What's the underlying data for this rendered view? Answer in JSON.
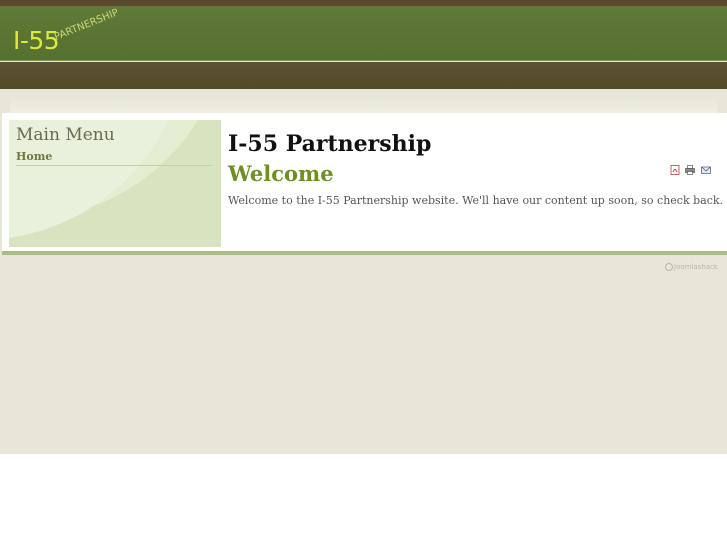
{
  "header": {
    "logo_main": "I-55",
    "logo_sub": "PARTNERSHIP"
  },
  "sidebar": {
    "title": "Main Menu",
    "items": [
      {
        "label": "Home"
      }
    ]
  },
  "main": {
    "title": "I-55 Partnership",
    "subtitle": "Welcome",
    "body": "Welcome to the I-55 Partnership website.  We'll have our content up soon, so check back."
  },
  "toolbar": {
    "icons": [
      "pdf-icon",
      "print-icon",
      "email-icon"
    ]
  },
  "footer": {
    "credit": "Joomlashack"
  },
  "colors": {
    "header_green": "#5a7432",
    "nav_brown": "#56492b",
    "page_bg": "#e8e6d6",
    "accent_green": "#6f8f22",
    "panel_bg": "#d8e4c0"
  }
}
